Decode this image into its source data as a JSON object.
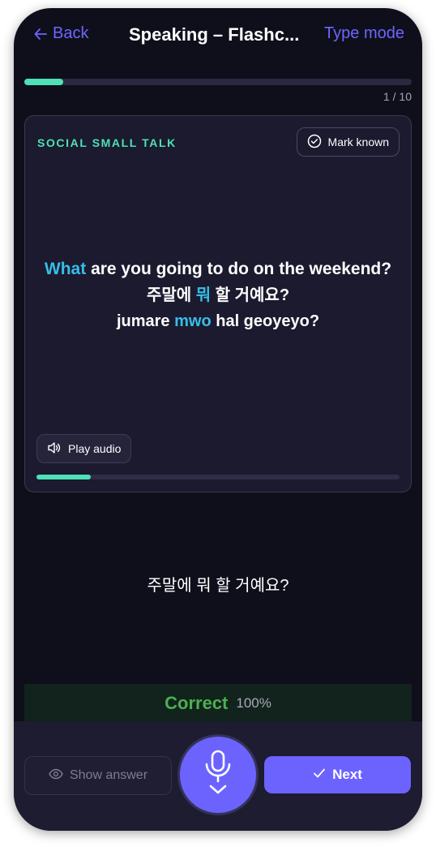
{
  "header": {
    "back_label": "Back",
    "title": "Speaking – Flashc...",
    "mode_label": "Type mode"
  },
  "progress": {
    "counter": "1 / 10",
    "fraction": 0.1
  },
  "card": {
    "category": "SOCIAL SMALL TALK",
    "mark_known_label": "Mark known",
    "english": {
      "highlight": "What",
      "rest": " are you going to do on the weekend?"
    },
    "korean": {
      "before": "주말에 ",
      "highlight": "뭐",
      "after": " 할 거예요?"
    },
    "romanization": {
      "before": "jumare ",
      "highlight": "mwo",
      "after": " hal geoyeyo?"
    },
    "play_audio_label": "Play audio",
    "audio_progress_fraction": 0.15
  },
  "transcript": "주말에 뭐 할 거예요?",
  "result": {
    "label": "Correct",
    "score": "100%"
  },
  "actions": {
    "show_answer_label": "Show answer",
    "next_label": "Next"
  },
  "colors": {
    "accent": "#6c63ff",
    "teal": "#4fe0b6",
    "highlight": "#38bde8",
    "correct": "#4caf50"
  }
}
